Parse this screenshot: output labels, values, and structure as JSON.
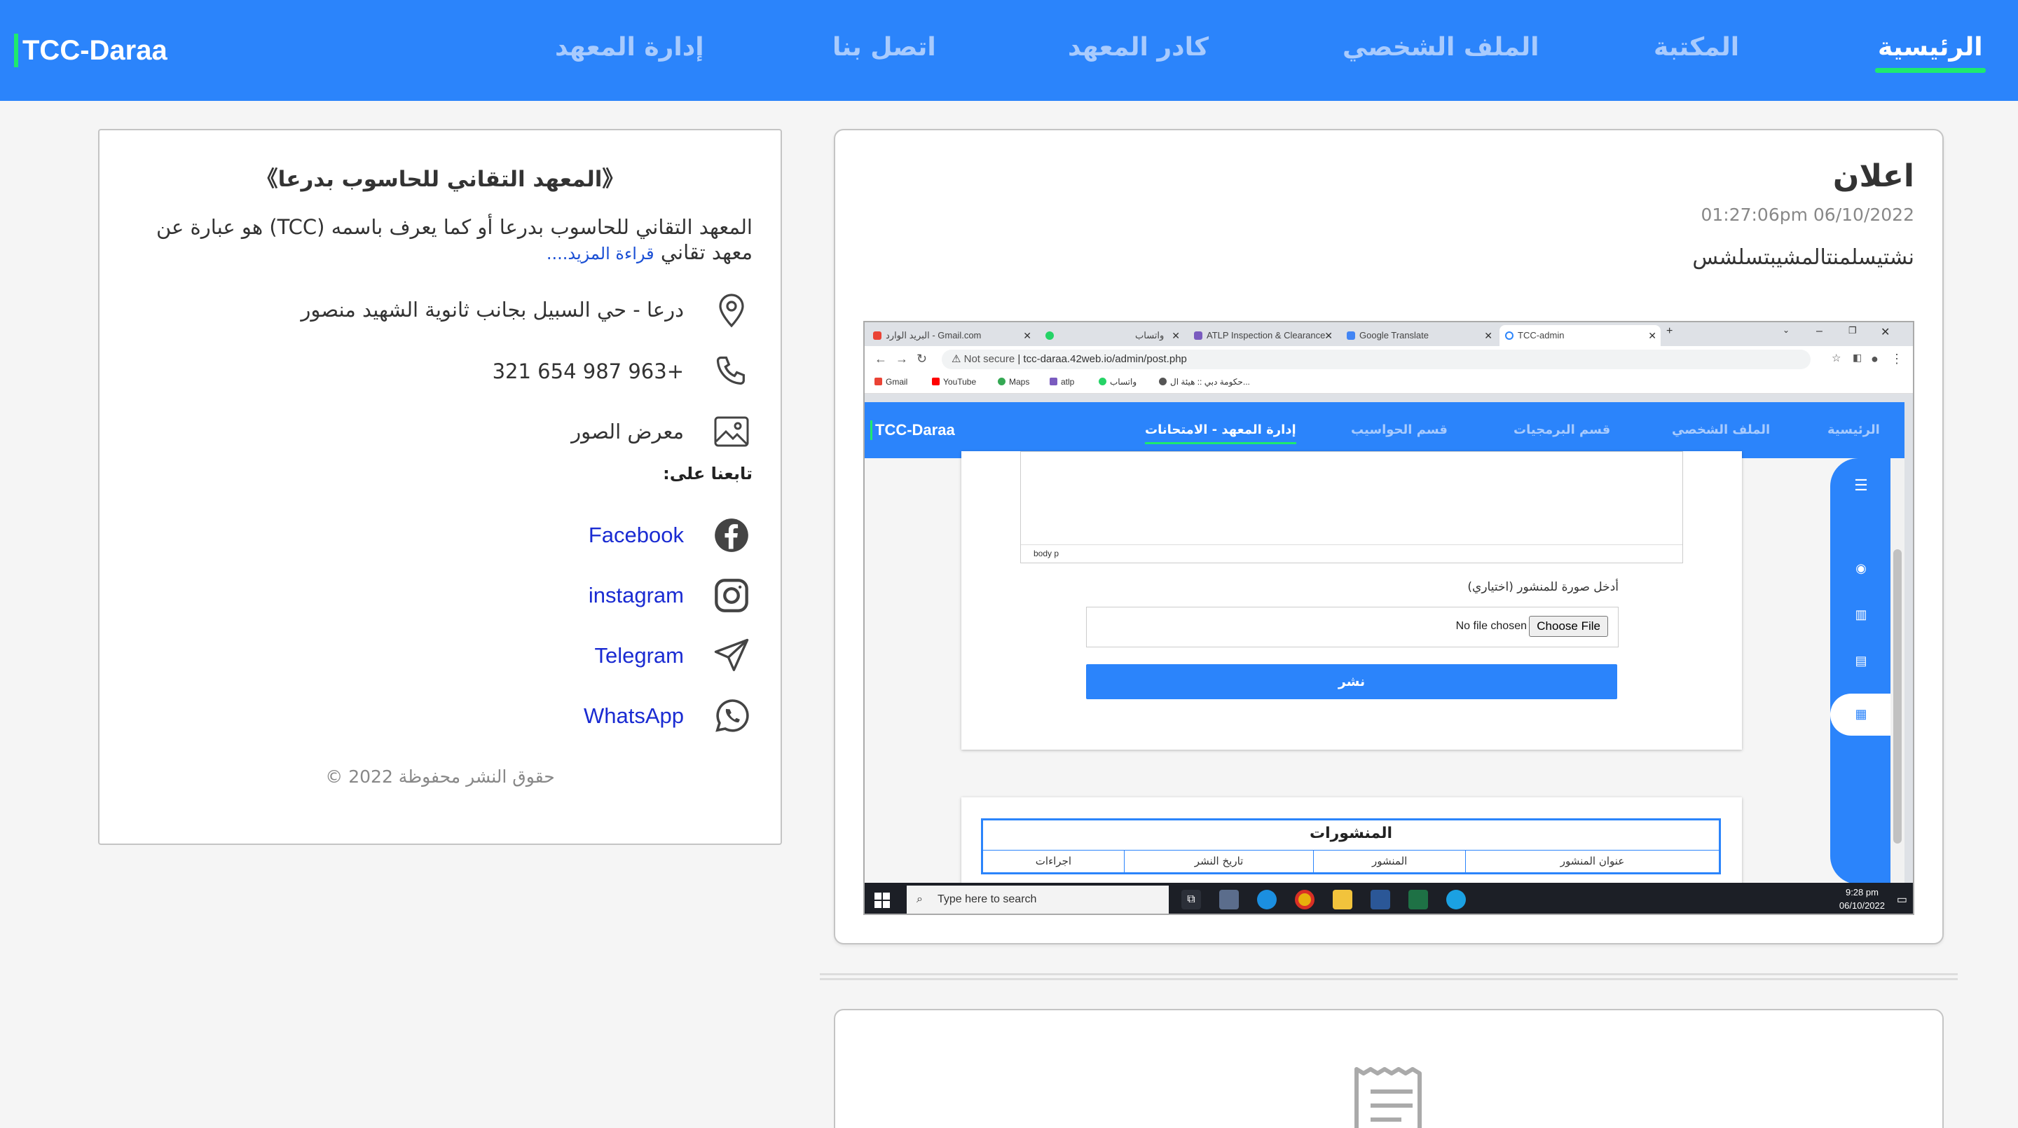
{
  "navbar": {
    "brand": "TCC-Daraa",
    "items": [
      {
        "label": "الرئيسية",
        "active": true
      },
      {
        "label": "المكتبة"
      },
      {
        "label": "الملف الشخصي"
      },
      {
        "label": "كادر المعهد"
      },
      {
        "label": "اتصل بنا"
      },
      {
        "label": "إدارة المعهد"
      }
    ]
  },
  "sidebar": {
    "title": "《المعهد التقاني للحاسوب بدرعا》",
    "description": "المعهد التقاني للحاسوب بدرعا أو كما يعرف باسمه (TCC) هو عبارة عن معهد تقاني",
    "read_more": "قراءة المزيد....",
    "address": "درعا - حي السبيل بجانب ثانوية الشهيد منصور",
    "phone": "+963 987 654 321",
    "gallery": "معرض الصور",
    "follow_label": "تابعنا على:",
    "social": [
      {
        "label": "Facebook",
        "icon": "facebook-icon"
      },
      {
        "label": "instagram",
        "icon": "instagram-icon"
      },
      {
        "label": "Telegram",
        "icon": "telegram-icon"
      },
      {
        "label": "WhatsApp",
        "icon": "whatsapp-icon"
      }
    ],
    "copyright": "حقوق النشر محفوظة 2022 ©"
  },
  "post": {
    "title": "اعلان",
    "date": "01:27:06pm 06/10/2022",
    "body": "نشتيسلمنتالمشيبتسلشس",
    "screenshot": {
      "tabs": [
        {
          "label": "البريد الوارد - Gmail.com"
        },
        {
          "label": "واتساب"
        },
        {
          "label": "ATLP Inspection & Clearance"
        },
        {
          "label": "Google Translate"
        },
        {
          "label": "TCC-admin",
          "active": true
        }
      ],
      "not_secure": "Not secure",
      "url": "tcc-daraa.42web.io/admin/post.php",
      "bookmarks": [
        "Gmail",
        "YouTube",
        "Maps",
        "atlp",
        "واتساب",
        "حكومة دبي :: هيئة ال..."
      ],
      "inner_brand": "TCC-Daraa",
      "inner_nav": [
        {
          "label": "الرئيسية"
        },
        {
          "label": "الملف الشخصي"
        },
        {
          "label": "قسم البرمجيات"
        },
        {
          "label": "قسم الحواسيب"
        },
        {
          "label": "إدارة المعهد - الامتحانات",
          "active": true
        }
      ],
      "editor_status": "body  p",
      "image_label": "أدخل صورة للمنشور (اختياري)",
      "choose_file": "Choose File",
      "no_file": "No file chosen",
      "publish": "نشر",
      "posts_title": "المنشورات",
      "posts_columns": [
        "عنوان المنشور",
        "المنشور",
        "تاريخ النشر",
        "اجراءات"
      ],
      "taskbar_search": "Type here to search",
      "clock_time": "9:28 pm",
      "clock_date": "06/10/2022"
    }
  },
  "colors": {
    "primary": "#2b84fb",
    "accent": "#1eea6e",
    "link": "#1a2bd2"
  }
}
